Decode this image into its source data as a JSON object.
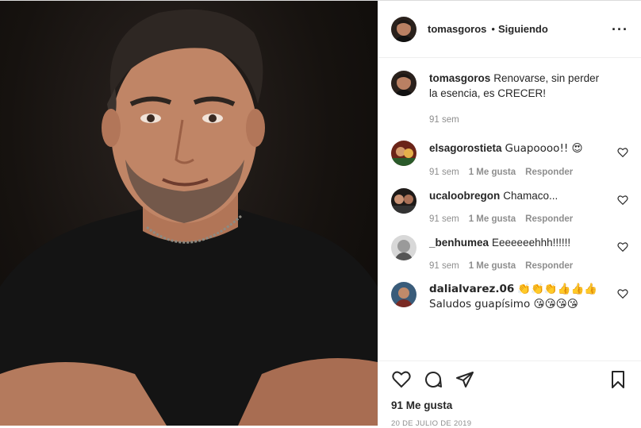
{
  "post": {
    "author": "tomasgoros",
    "follow_separator": "•",
    "follow_status": "Siguiendo",
    "more_icon": "more-icon",
    "caption": {
      "username": "tomasgoros",
      "text": "Renovarse, sin perder la esencia, es CRECER!",
      "time": "91 sem"
    },
    "comments": [
      {
        "username": "elsagorostieta",
        "text": "Guapoooo!! 😍",
        "time": "91 sem",
        "likes": "1 Me gusta",
        "reply": "Responder"
      },
      {
        "username": "ucaloobregon",
        "text": "Chamaco...",
        "time": "91 sem",
        "likes": "1 Me gusta",
        "reply": "Responder"
      },
      {
        "username": "_benhumea",
        "text": "Eeeeeeehhh!!!!!!",
        "time": "91 sem",
        "likes": "1 Me gusta",
        "reply": "Responder"
      },
      {
        "username": "dalialvarez.06",
        "text": "👏👏👏👍👍👍 Saludos guapísimo 😘😘😘😘",
        "time": "",
        "likes": "",
        "reply": ""
      }
    ],
    "likes_count": "91 Me gusta",
    "date": "20 DE JULIO DE 2019",
    "icons": [
      "heart-icon",
      "comment-icon",
      "share-icon",
      "bookmark-icon"
    ]
  }
}
